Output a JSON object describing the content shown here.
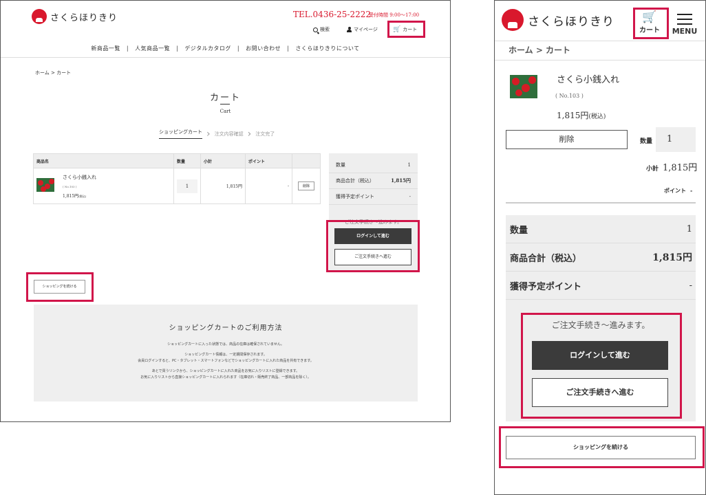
{
  "brand": {
    "name": "さくらほりきり",
    "accent": "#d9182d",
    "highlight": "#d1154a"
  },
  "header": {
    "tel": "TEL.0436-25-2222",
    "hours": "受付時間 9:00～17:00",
    "search_label": "検索",
    "mypage_label": "マイページ",
    "cart_label": "カート"
  },
  "global_nav": [
    "新商品一覧",
    "人気商品一覧",
    "デジタルカタログ",
    "お問い合わせ",
    "さくらほりきりについて"
  ],
  "breadcrumb": "ホーム > カート",
  "page": {
    "title": "カート",
    "subtitle": "Cart"
  },
  "steps": [
    "ショッピングカート",
    "注文内容確認",
    "注文完了"
  ],
  "table": {
    "headers": [
      "商品名",
      "数量",
      "小計",
      "ポイント",
      ""
    ],
    "item": {
      "name": "さくら小銭入れ",
      "code": "( No.103 )",
      "price": "1,815円",
      "tax": "(税込)",
      "qty": "1",
      "subtotal": "1,815円",
      "points": "-",
      "delete": "削除"
    }
  },
  "summary": {
    "qty_label": "数量",
    "qty": "1",
    "total_label": "商品合計（税込）",
    "total": "1,815円",
    "points_label": "獲得予定ポイント",
    "points": "-",
    "notice": "ご注文手続き～進みます。",
    "login_button": "ログインして進む",
    "guest_button": "ご注文手続きへ進む"
  },
  "continue_button": "ショッピングを続ける",
  "howto": {
    "title": "ショッピングカートのご利用方法",
    "lines": [
      "ショッピングカートに入った状態では、商品の在庫は確保されていません。",
      "ショッピングカート情報は、一定期間保存されます。",
      "会員ログインすると、PC・タブレット・スマートフォンなどでショッピングカートに入れた商品を共有できます。",
      "あとで買うリンクから、ショッピングカートに入れた商品をお気に入りリストに登録できます。",
      "お気に入りリストから直接ショッピングカートに入れられます（在庫切れ・販売終了商品、一部商品を除く）。"
    ]
  },
  "sp": {
    "cart_label": "カート",
    "menu_label": "MENU",
    "qty_label": "数量",
    "subtotal_label": "小計",
    "subtotal": "1,815円",
    "points_label": "ポイント",
    "points": "-"
  }
}
